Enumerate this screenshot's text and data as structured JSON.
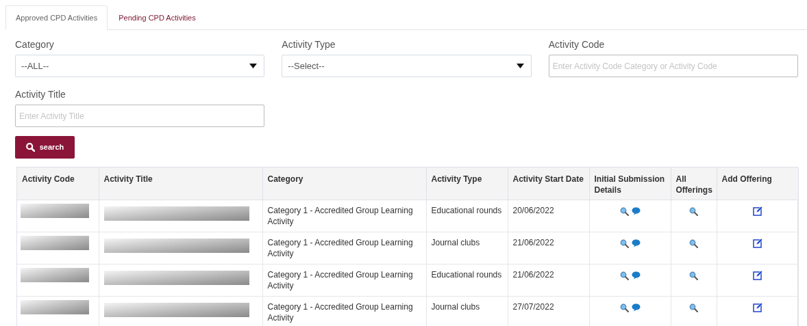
{
  "tabs": [
    {
      "label": "Approved CPD Activities",
      "selected": true
    },
    {
      "label": "Pending CPD Activities",
      "selected": false
    }
  ],
  "filters": [
    {
      "kind": "select",
      "label": "Category",
      "value": "--ALL--"
    },
    {
      "kind": "select",
      "label": "Activity Type",
      "value": "--Select--"
    },
    {
      "kind": "input",
      "label": "Activity Code",
      "placeholder": "Enter Activity Code Category or Activity Code"
    },
    {
      "kind": "input",
      "label": "Activity Title",
      "placeholder": "Enter Activity Title"
    }
  ],
  "search_button": "search",
  "table": {
    "columns": [
      "Activity Code",
      "Activity Title",
      "Category",
      "Activity Type",
      "Activity Start Date",
      "Initial Submission Details",
      "All Offerings",
      "Add Offering"
    ],
    "rows": [
      {
        "category": "Category 1 - Accredited Group Learning Activity",
        "activity_type": "Educational rounds",
        "start_date": "20/06/2022"
      },
      {
        "category": "Category 1 - Accredited Group Learning Activity",
        "activity_type": "Journal clubs",
        "start_date": "21/06/2022"
      },
      {
        "category": "Category 1 - Accredited Group Learning Activity",
        "activity_type": "Educational rounds",
        "start_date": "21/06/2022"
      },
      {
        "category": "Category 1 - Accredited Group Learning Activity",
        "activity_type": "Journal clubs",
        "start_date": "27/07/2022"
      }
    ]
  }
}
